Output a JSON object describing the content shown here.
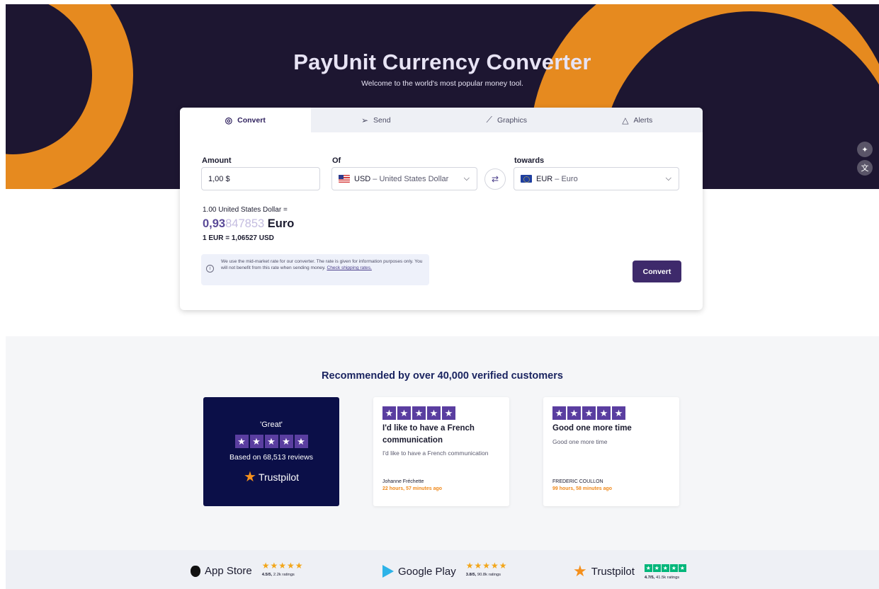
{
  "hero": {
    "title": "PayUnit Currency Converter",
    "subtitle": "Welcome to the world's most popular money tool."
  },
  "side_icons": [
    {
      "icon": "sparkle-icon",
      "glyph": "✦"
    },
    {
      "icon": "translate-icon",
      "glyph": "文"
    }
  ],
  "tabs": [
    {
      "label": "Convert",
      "icon": "coins-icon",
      "glyph": "◎",
      "active": true
    },
    {
      "label": "Send",
      "icon": "send-icon",
      "glyph": "➢",
      "active": false
    },
    {
      "label": "Graphics",
      "icon": "chart-icon",
      "glyph": "⟋",
      "active": false
    },
    {
      "label": "Alerts",
      "icon": "bell-icon",
      "glyph": "△",
      "active": false
    }
  ],
  "converter": {
    "amount_label": "Amount",
    "amount_value": "1,00 $",
    "of_label": "Of",
    "from_code": "USD",
    "from_name": "– United States Dollar",
    "towards_label": "towards",
    "to_code": "EUR",
    "to_name": "– Euro",
    "result_line": "1.00 United States Dollar =",
    "result_main": "0,93",
    "result_faded": "847853",
    "result_currency": "Euro",
    "rate_line": "1 EUR = 1,06527 USD",
    "notice_text": "We use the mid-market rate for our converter. The rate is given for information purposes only. You will not benefit from this rate when sending money.",
    "notice_link": "Check shipping rates.",
    "convert_button": "Convert"
  },
  "reviews": {
    "title": "Recommended by over 40,000 verified customers",
    "trustpilot": {
      "rating_word": "'Great'",
      "based_on": "Based on 68,513 reviews",
      "brand": "Trustpilot"
    },
    "items": [
      {
        "headline": "I'd like to have a French communication",
        "body": "I'd like to have a French communication",
        "author": "Johanne Fréchette",
        "time": "22 hours, 57 minutes ago"
      },
      {
        "headline": "Good one more time",
        "body": "Good one more time",
        "author": "FREDERIC COULLON",
        "time": "99 hours, 58 minutes ago"
      }
    ]
  },
  "footer": {
    "stores": [
      {
        "name": "App Store",
        "score": "4.5/5,",
        "count": "2.2k ratings"
      },
      {
        "name": "Google Play",
        "score": "3.8/5,",
        "count": "90.8k ratings"
      },
      {
        "name": "Trustpilot",
        "score": "4.7/5,",
        "count": "41.5k ratings"
      }
    ]
  },
  "colors": {
    "hero_bg": "#1d1631",
    "accent_orange": "#e68a1f",
    "primary_purple": "#3e2a6b",
    "trustpilot_navy": "#0b0f48",
    "trustpilot_green": "#00b67a"
  }
}
